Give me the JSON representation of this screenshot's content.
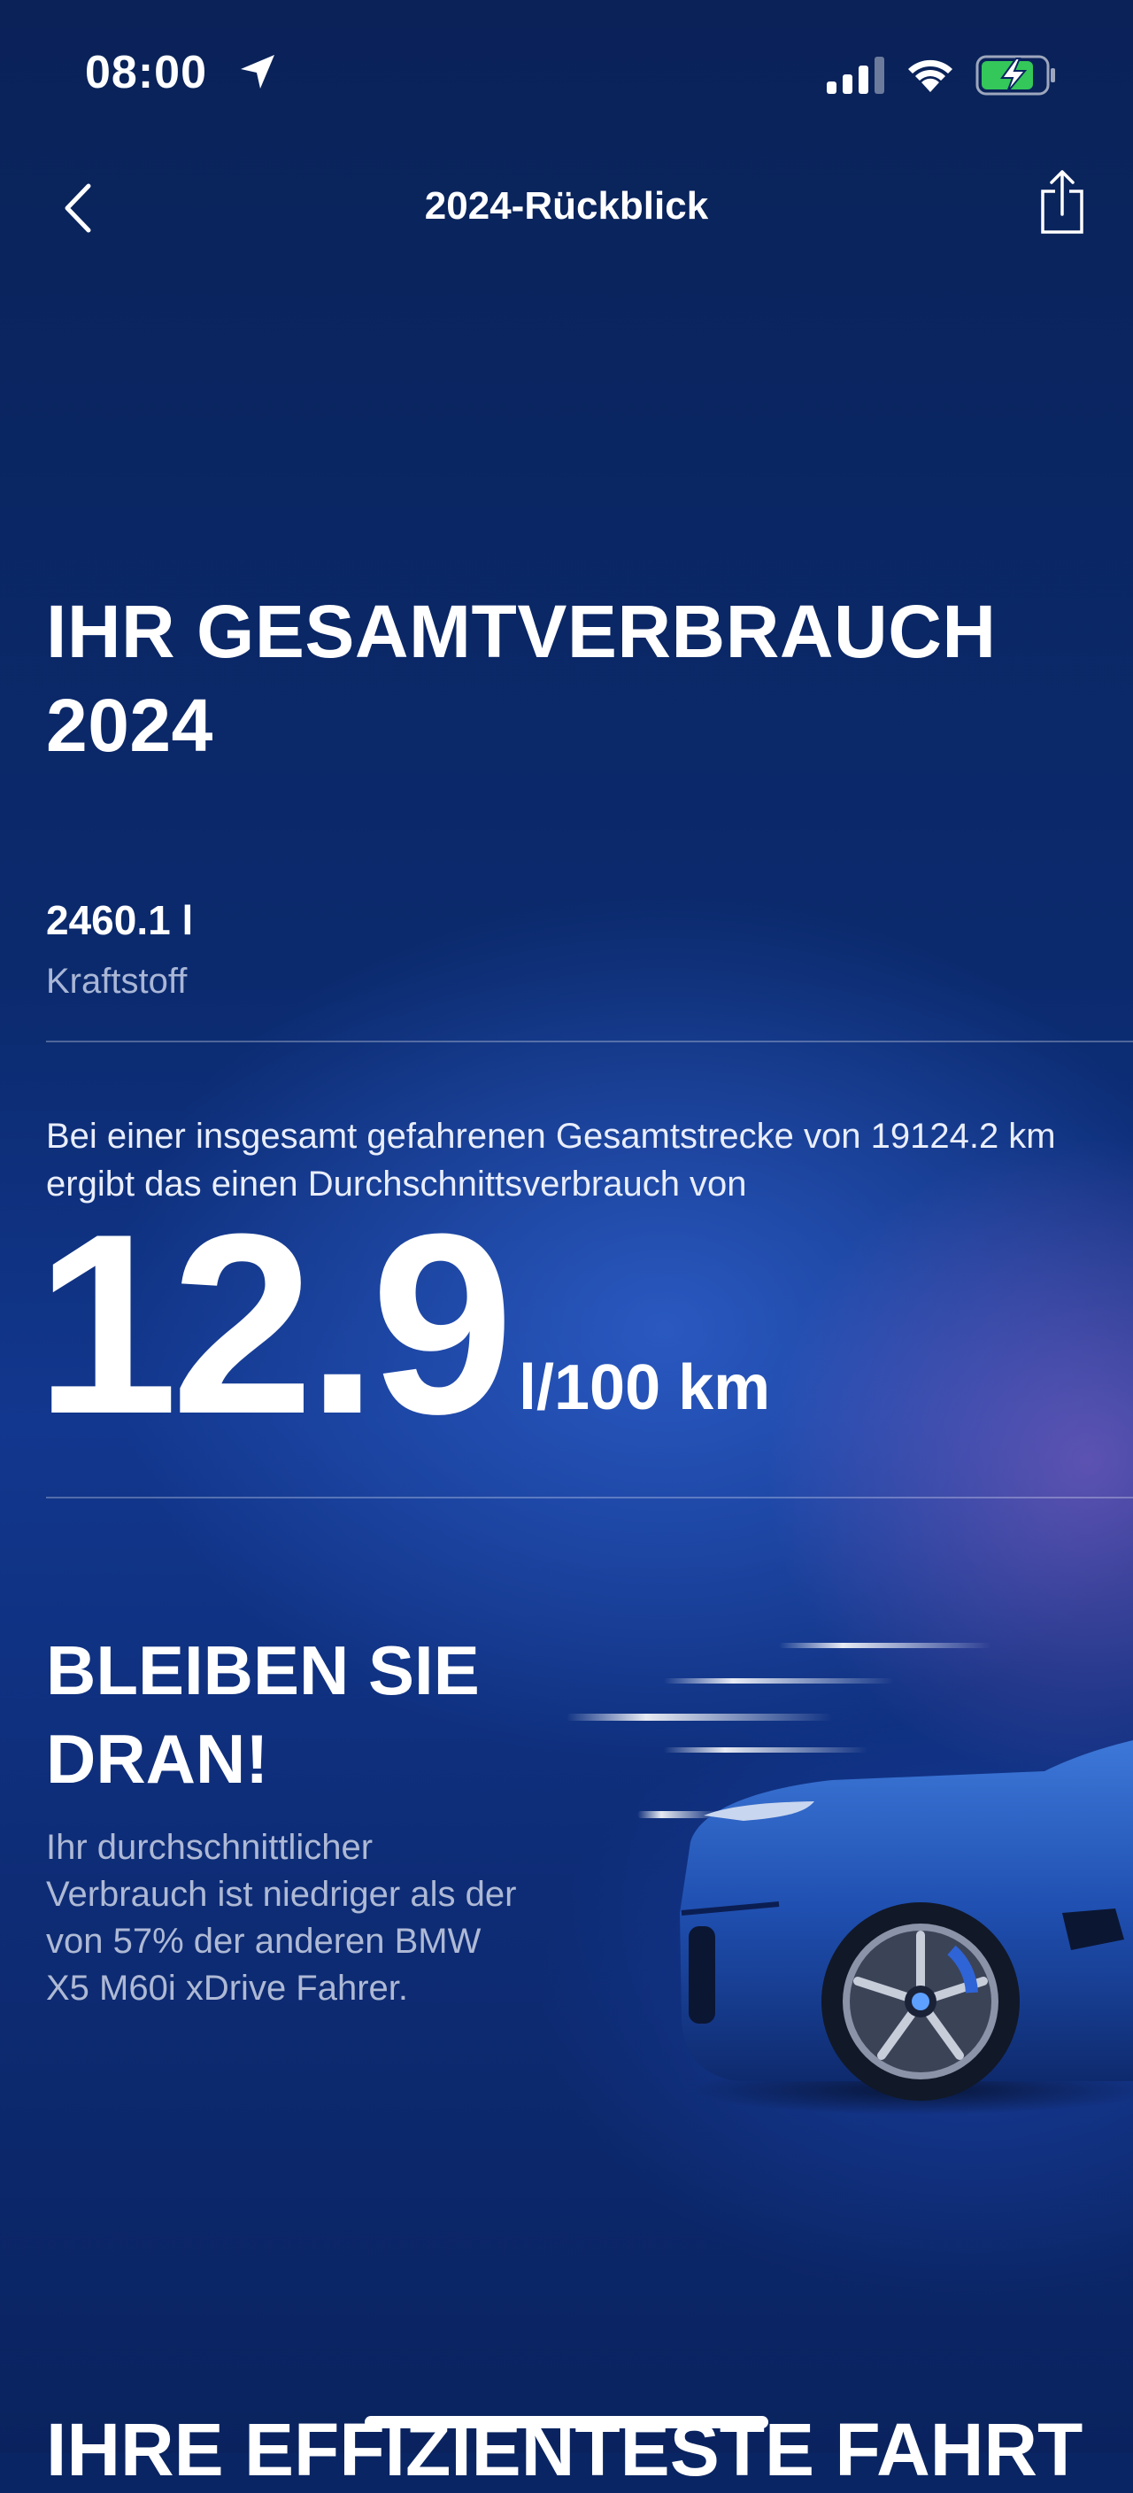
{
  "status_bar": {
    "time": "08:00"
  },
  "nav": {
    "title": "2024-Rückblick"
  },
  "summary": {
    "headline": "IHR GESAMTVERBRAUCH 2024",
    "amount": "2460.1 l",
    "amount_label": "Kraftstoff",
    "description": "Bei einer insgesamt gefahrenen Gesamtstrecke von 19124.2 km ergibt das einen Durchschnittsverbrauch von",
    "average_value": "12.9",
    "average_unit": "l/100 km"
  },
  "motivation": {
    "title": "BLEIBEN SIE DRAN!",
    "text": "Ihr durchschnittlicher Verbrauch ist niedriger als der von 57% der anderen BMW X5 M60i xDrive Fahrer."
  },
  "next_section": {
    "title": "IHRE EFFIZIENTESTE FAHRT"
  },
  "colors": {
    "background": "#0a2563",
    "accent_blue": "#1f4fb0",
    "battery_green": "#34c759"
  },
  "icons": [
    "location-arrow-icon",
    "cellular-signal-icon",
    "wifi-icon",
    "battery-charging-icon",
    "back-chevron-icon",
    "share-icon"
  ]
}
